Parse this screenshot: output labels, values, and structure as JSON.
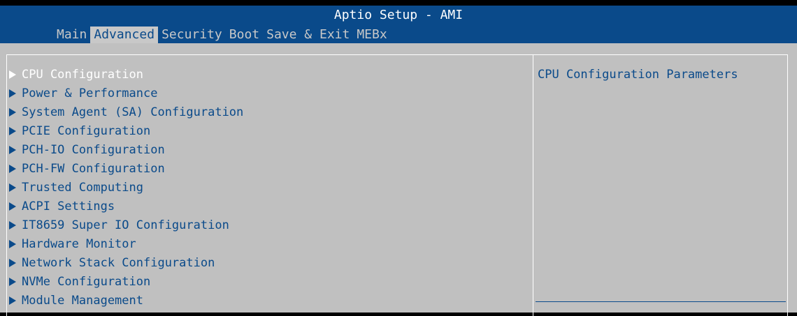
{
  "header": {
    "title": "Aptio Setup - AMI",
    "tabs": [
      {
        "label": "Main",
        "active": false
      },
      {
        "label": "Advanced",
        "active": true
      },
      {
        "label": "Security",
        "active": false
      },
      {
        "label": "Boot",
        "active": false
      },
      {
        "label": "Save & Exit",
        "active": false
      },
      {
        "label": "MEBx",
        "active": false
      }
    ]
  },
  "menu": {
    "items": [
      {
        "label": "CPU Configuration",
        "selected": true
      },
      {
        "label": "Power & Performance",
        "selected": false
      },
      {
        "label": "System Agent (SA) Configuration",
        "selected": false
      },
      {
        "label": "PCIE Configuration",
        "selected": false
      },
      {
        "label": "PCH-IO Configuration",
        "selected": false
      },
      {
        "label": "PCH-FW Configuration",
        "selected": false
      },
      {
        "label": "Trusted Computing",
        "selected": false
      },
      {
        "label": "ACPI Settings",
        "selected": false
      },
      {
        "label": "IT8659 Super IO Configuration",
        "selected": false
      },
      {
        "label": "Hardware Monitor",
        "selected": false
      },
      {
        "label": "Network Stack Configuration",
        "selected": false
      },
      {
        "label": "NVMe Configuration",
        "selected": false
      },
      {
        "label": "Module Management",
        "selected": false
      }
    ],
    "submenu_icon": "right-triangle-icon"
  },
  "help": {
    "text": "CPU Configuration Parameters"
  },
  "colors": {
    "header_bg": "#0a4a8a",
    "content_bg": "#c0c0c0",
    "text_blue": "#0a4a8a",
    "selected_text": "#ffffff",
    "tab_inactive": "#c8c8c8"
  }
}
